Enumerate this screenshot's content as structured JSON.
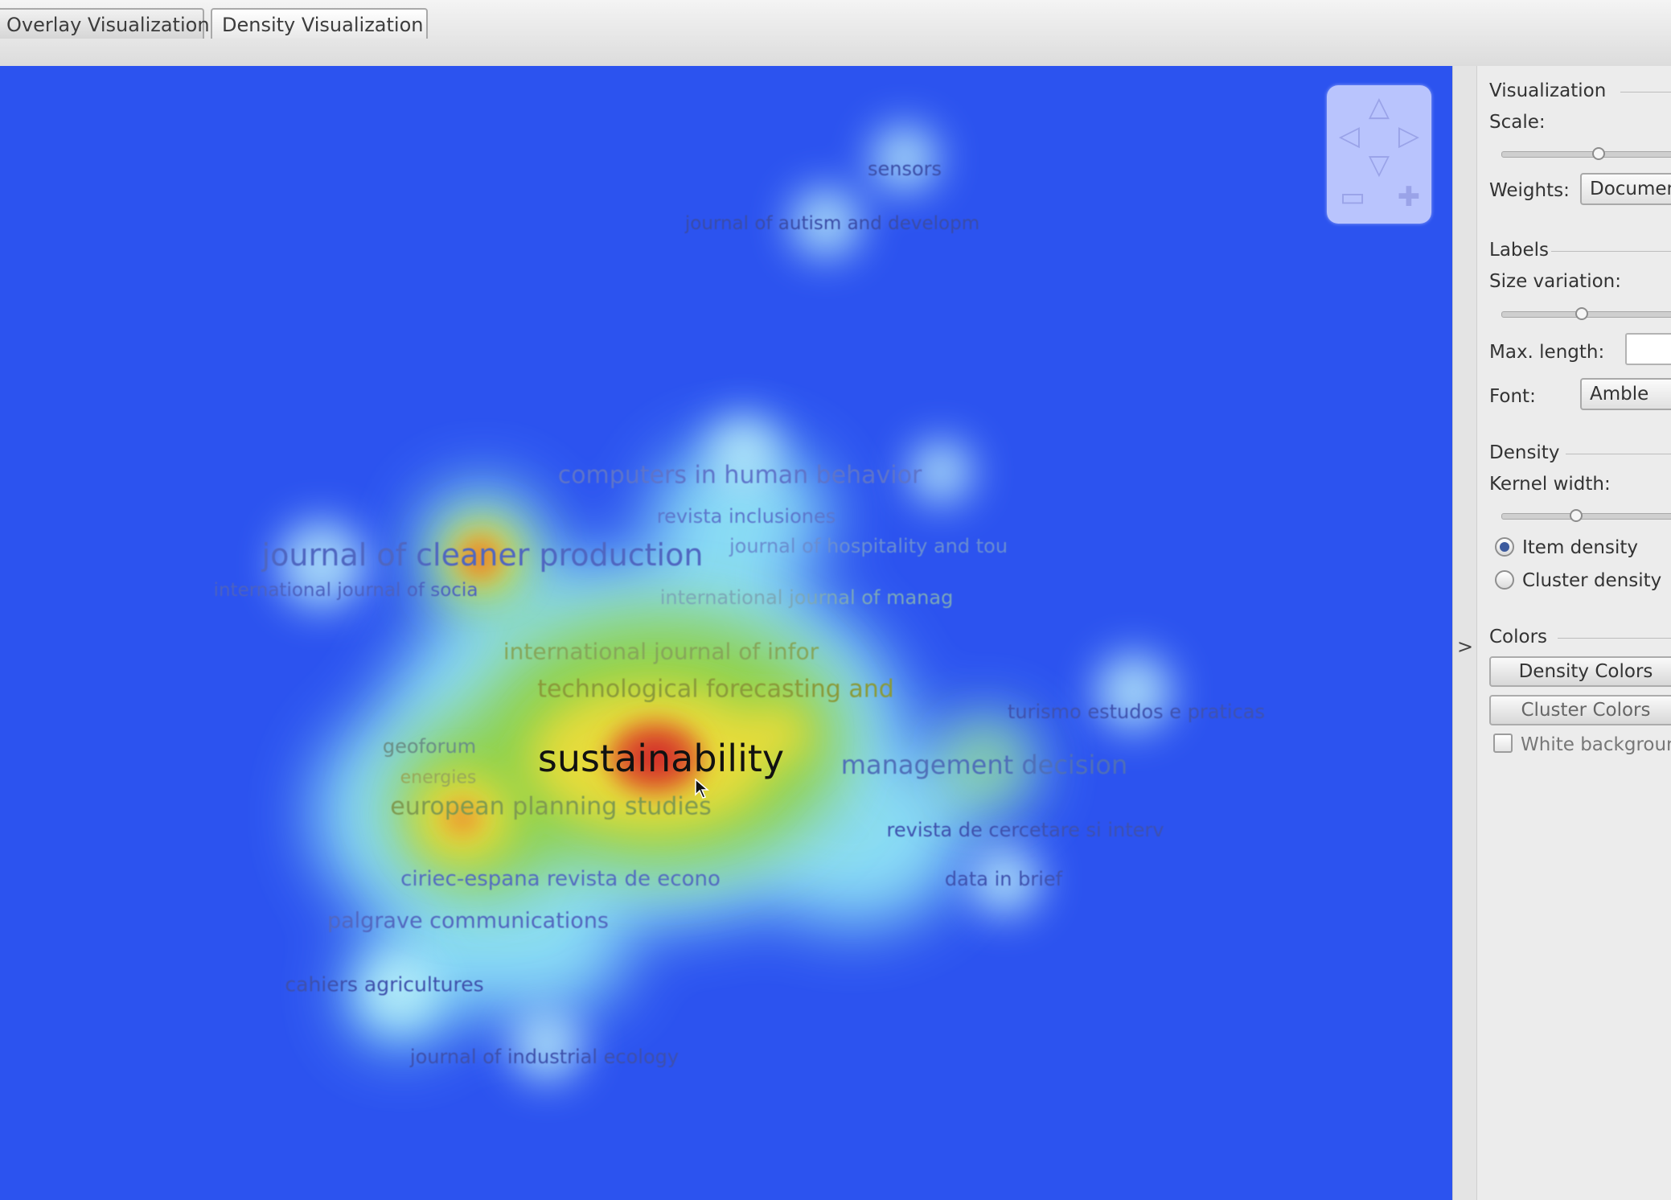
{
  "tabs": [
    {
      "label": "Overlay Visualization"
    },
    {
      "label": "Density Visualization"
    }
  ],
  "map": {
    "labels": [
      {
        "text": "sensors",
        "color": "#3c4fa8",
        "size": 24
      },
      {
        "text": "journal of autism and developm",
        "color": "#3a4ca6",
        "size": 23
      },
      {
        "text": "computers in human behavior",
        "color": "#5e74c9",
        "size": 30
      },
      {
        "text": "revista inclusiones",
        "color": "#5c77cc",
        "size": 24
      },
      {
        "text": "journal of hospitality and tou",
        "color": "#6a8ed0",
        "size": 24
      },
      {
        "text": "journal of cleaner production",
        "color": "#4f66c0",
        "size": 38
      },
      {
        "text": "international journal of socia",
        "color": "#4d62be",
        "size": 23
      },
      {
        "text": "international journal of manag",
        "color": "#7ca8b8",
        "size": 24
      },
      {
        "text": "international journal of infor",
        "color": "#86a65a",
        "size": 28
      },
      {
        "text": "technological forecasting and",
        "color": "#8a9a3a",
        "size": 30
      },
      {
        "text": "turismo estudos e praticas",
        "color": "#3f52ae",
        "size": 24
      },
      {
        "text": "geoforum",
        "color": "#6a8e86",
        "size": 24
      },
      {
        "text": "sustainability",
        "color": "#111111",
        "size": 46
      },
      {
        "text": "management decision",
        "color": "#4f6fb8",
        "size": 32
      },
      {
        "text": "energies",
        "color": "#98a85a",
        "size": 22
      },
      {
        "text": "european planning studies",
        "color": "#7f9a50",
        "size": 30
      },
      {
        "text": "revista de cercetare si interv",
        "color": "#3e51ad",
        "size": 24
      },
      {
        "text": "ciriec-espana revista de econo",
        "color": "#536cc0",
        "size": 26
      },
      {
        "text": "data in brief",
        "color": "#3f52ae",
        "size": 24
      },
      {
        "text": "palgrave communications",
        "color": "#5267bf",
        "size": 27
      },
      {
        "text": "cahiers agricultures",
        "color": "#3e50ab",
        "size": 25
      },
      {
        "text": "journal of industrial ecology",
        "color": "#3e50ab",
        "size": 24
      }
    ]
  },
  "panel": {
    "visualization": {
      "heading": "Visualization",
      "scale_label": "Scale:",
      "weights_label": "Weights:",
      "weights_value": "Documents"
    },
    "labels": {
      "heading": "Labels",
      "size_variation_label": "Size variation:",
      "max_length_label": "Max. length:",
      "max_length_value": "",
      "font_label": "Font:",
      "font_value": "Amble"
    },
    "density": {
      "heading": "Density",
      "kernel_width_label": "Kernel width:",
      "item_density_label": "Item density",
      "cluster_density_label": "Cluster density",
      "selected": "item"
    },
    "colors": {
      "heading": "Colors",
      "density_colors_button": "Density Colors",
      "cluster_colors_button": "Cluster Colors",
      "white_background_label": "White background"
    }
  },
  "colors": {
    "map_background": "#2c53ef",
    "density_hot": "#d9352a",
    "density_warm": "#e8d93a",
    "density_mid": "#8ed44a",
    "density_cool": "#9eeaf3"
  }
}
